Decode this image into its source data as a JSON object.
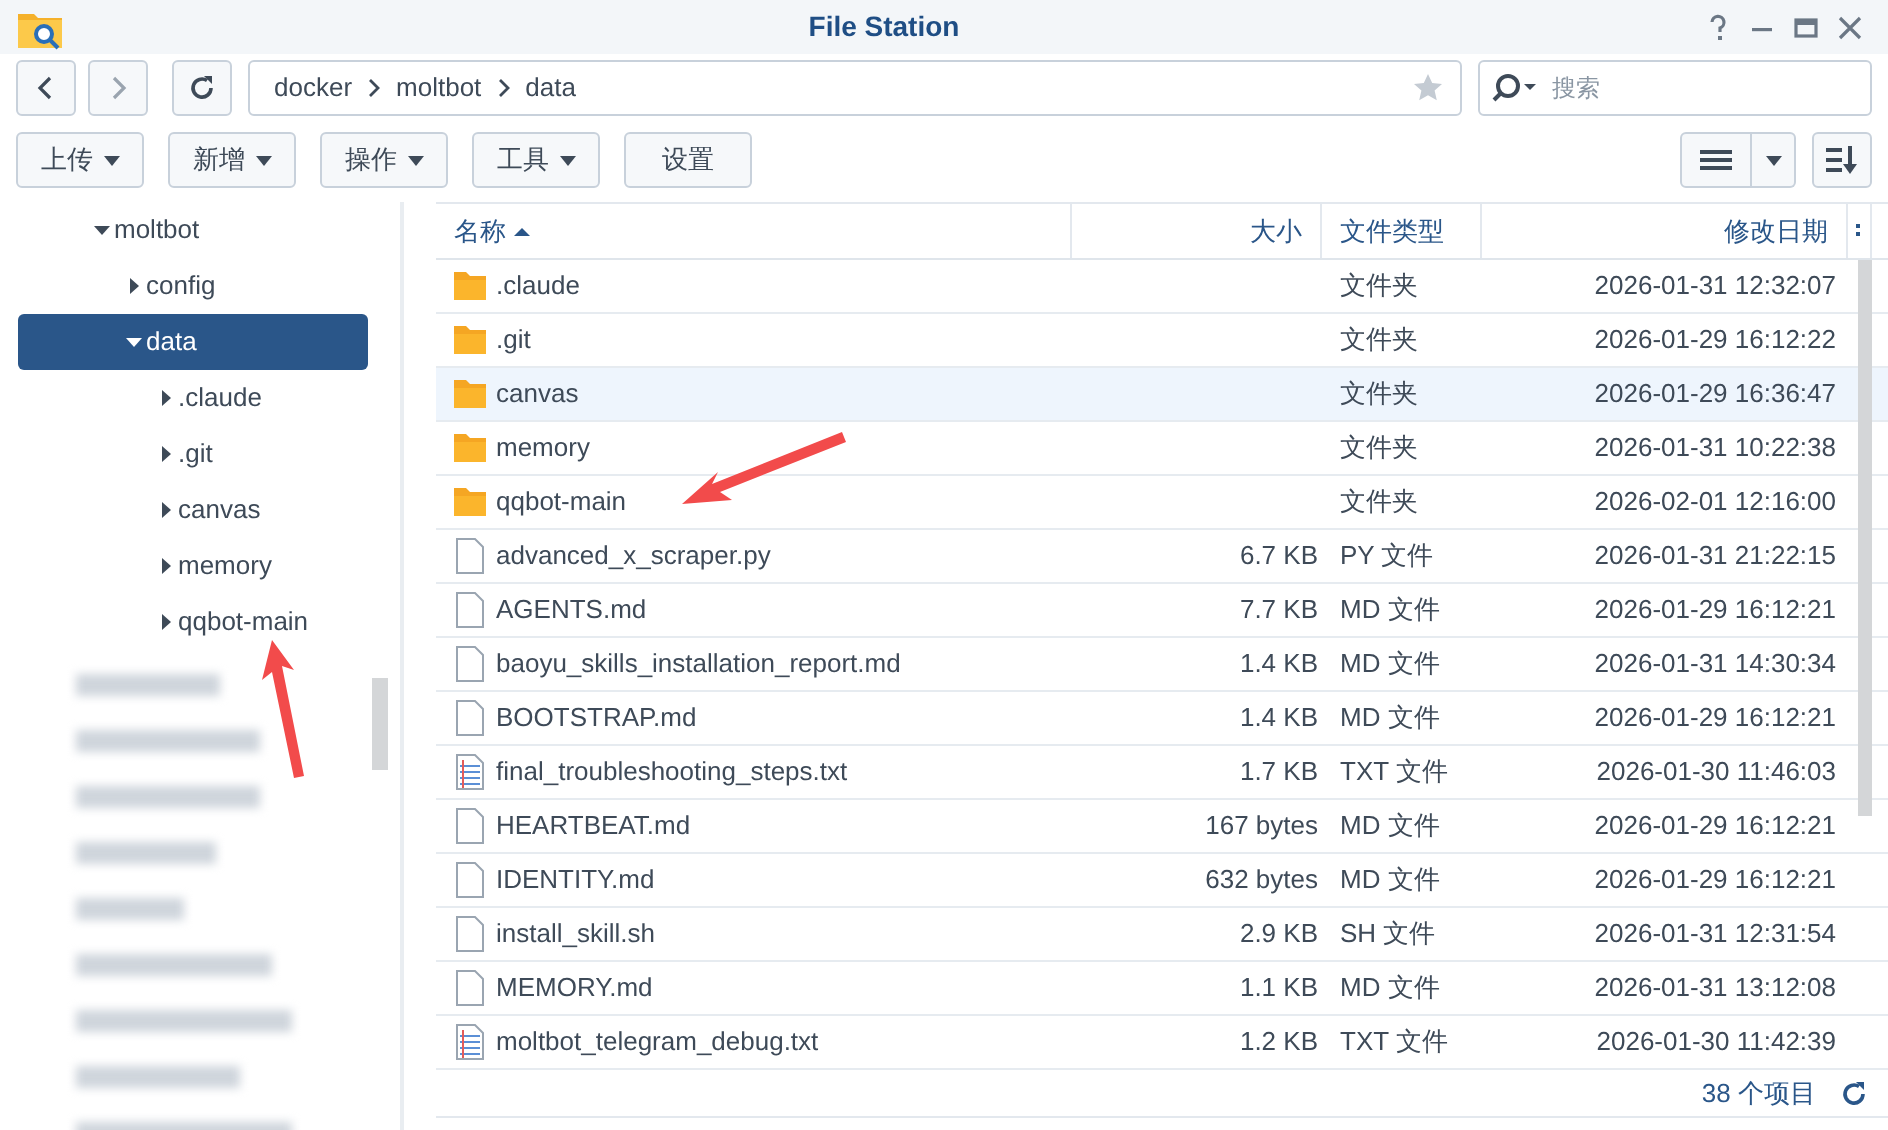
{
  "window": {
    "title": "File Station"
  },
  "path": {
    "segments": [
      "docker",
      "moltbot",
      "data"
    ],
    "favorite": false
  },
  "search": {
    "placeholder": "搜索"
  },
  "toolbar": {
    "buttons": [
      {
        "label": "上传",
        "dropdown": true
      },
      {
        "label": "新增",
        "dropdown": true
      },
      {
        "label": "操作",
        "dropdown": true
      },
      {
        "label": "工具",
        "dropdown": true
      },
      {
        "label": "设置",
        "dropdown": false
      }
    ]
  },
  "sidebar": {
    "items": [
      {
        "label": "moltbot",
        "expanded": true,
        "selected": false,
        "children": [
          {
            "label": "config",
            "expanded": false,
            "selected": false
          },
          {
            "label": "data",
            "expanded": true,
            "selected": true,
            "children": [
              {
                "label": ".claude",
                "expanded": false,
                "selected": false
              },
              {
                "label": ".git",
                "expanded": false,
                "selected": false
              },
              {
                "label": "canvas",
                "expanded": false,
                "selected": false
              },
              {
                "label": "memory",
                "expanded": false,
                "selected": false
              },
              {
                "label": "qqbot-main",
                "expanded": false,
                "selected": false
              }
            ]
          }
        ]
      }
    ],
    "redacted": [
      {
        "kind": "redacted"
      },
      {
        "kind": "redacted"
      },
      {
        "kind": "redacted"
      },
      {
        "kind": "redacted"
      },
      {
        "kind": "redacted"
      },
      {
        "kind": "redacted"
      },
      {
        "kind": "redacted"
      },
      {
        "kind": "redacted"
      },
      {
        "kind": "redacted"
      }
    ]
  },
  "table": {
    "columns": [
      {
        "label": "名称",
        "sorted": true
      },
      {
        "label": "大小",
        "sorted": false
      },
      {
        "label": "文件类型",
        "sorted": false
      },
      {
        "label": "修改日期",
        "sorted": false
      }
    ],
    "rows": [
      {
        "kind": "folder",
        "name": ".claude",
        "type": "文件夹",
        "modified": "2026-01-31 12:32:07",
        "selected": false
      },
      {
        "kind": "folder",
        "name": ".git",
        "type": "文件夹",
        "modified": "2026-01-29 16:12:22",
        "selected": false
      },
      {
        "kind": "folder",
        "name": "canvas",
        "type": "文件夹",
        "modified": "2026-01-29 16:36:47",
        "selected": true
      },
      {
        "kind": "folder",
        "name": "memory",
        "type": "文件夹",
        "modified": "2026-01-31 10:22:38",
        "selected": false
      },
      {
        "kind": "folder",
        "name": "qqbot-main",
        "type": "文件夹",
        "modified": "2026-02-01 12:16:00",
        "selected": false
      },
      {
        "kind": "file",
        "name": "advanced_x_scraper.py",
        "size": "6.7 KB",
        "type": "PY 文件",
        "modified": "2026-01-31 21:22:15",
        "selected": false
      },
      {
        "kind": "file",
        "name": "AGENTS.md",
        "size": "7.7 KB",
        "type": "MD 文件",
        "modified": "2026-01-29 16:12:21",
        "selected": false
      },
      {
        "kind": "file",
        "name": "baoyu_skills_installation_report.md",
        "size": "1.4 KB",
        "type": "MD 文件",
        "modified": "2026-01-31 14:30:34",
        "selected": false
      },
      {
        "kind": "file",
        "name": "BOOTSTRAP.md",
        "size": "1.4 KB",
        "type": "MD 文件",
        "modified": "2026-01-29 16:12:21",
        "selected": false
      },
      {
        "kind": "text",
        "name": "final_troubleshooting_steps.txt",
        "size": "1.7 KB",
        "type": "TXT 文件",
        "modified": "2026-01-30 11:46:03",
        "selected": false
      },
      {
        "kind": "file",
        "name": "HEARTBEAT.md",
        "size": "167 bytes",
        "type": "MD 文件",
        "modified": "2026-01-29 16:12:21",
        "selected": false
      },
      {
        "kind": "file",
        "name": "IDENTITY.md",
        "size": "632 bytes",
        "type": "MD 文件",
        "modified": "2026-01-29 16:12:21",
        "selected": false
      },
      {
        "kind": "file",
        "name": "install_skill.sh",
        "size": "2.9 KB",
        "type": "SH 文件",
        "modified": "2026-01-31 12:31:54",
        "selected": false
      },
      {
        "kind": "file",
        "name": "MEMORY.md",
        "size": "1.1 KB",
        "type": "MD 文件",
        "modified": "2026-01-31 13:12:08",
        "selected": false
      },
      {
        "kind": "text",
        "name": "moltbot_telegram_debug.txt",
        "size": "1.2 KB",
        "type": "TXT 文件",
        "modified": "2026-01-30 11:42:39",
        "selected": false
      }
    ]
  },
  "status_bar": {
    "count": "38 个项目"
  },
  "annotations": [
    {
      "kind": "arrow"
    },
    {
      "kind": "arrow"
    }
  ]
}
